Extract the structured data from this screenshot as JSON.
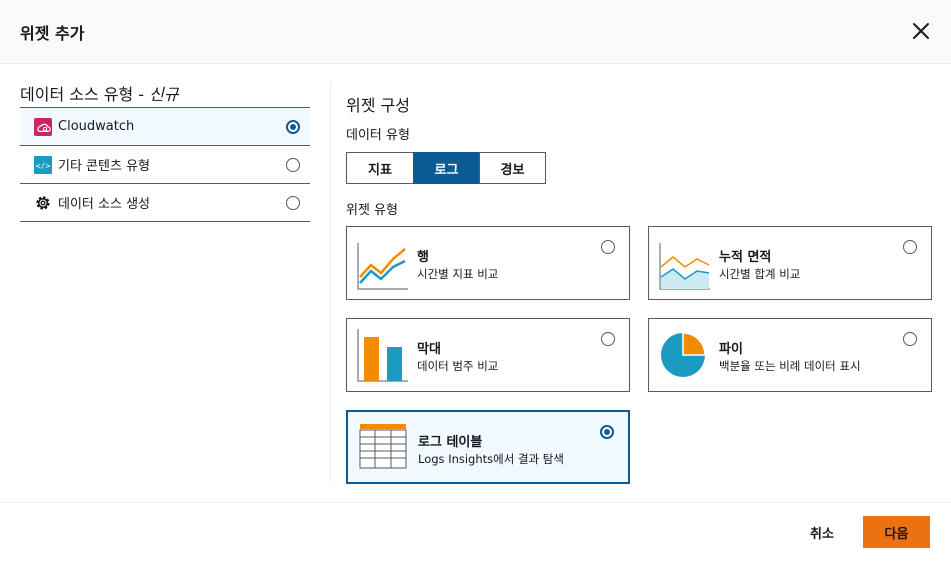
{
  "header": {
    "title": "위젯 추가"
  },
  "sources": {
    "title": "데이터 소스 유형 - ",
    "title_new": "신규",
    "items": [
      {
        "label": "Cloudwatch",
        "icon": "cloudwatch-icon",
        "selected": true
      },
      {
        "label": "기타 콘텐츠 유형",
        "icon": "code-icon",
        "selected": false
      },
      {
        "label": "데이터 소스 생성",
        "icon": "gear-icon",
        "selected": false
      }
    ]
  },
  "config": {
    "title": "위젯 구성",
    "data_type_label": "데이터 유형",
    "data_types": [
      "지표",
      "로그",
      "경보"
    ],
    "selected_data_type": "로그",
    "widget_type_label": "위젯 유형",
    "widgets": [
      {
        "name": "행",
        "desc": "시간별 지표 비교",
        "icon": "line-chart-icon",
        "selected": false
      },
      {
        "name": "누적 면적",
        "desc": "시간별 합계 비교",
        "icon": "stacked-area-icon",
        "selected": false
      },
      {
        "name": "막대",
        "desc": "데이터 범주 비교",
        "icon": "bar-chart-icon",
        "selected": false
      },
      {
        "name": "파이",
        "desc": "백분율 또는 비례 데이터 표시",
        "icon": "pie-chart-icon",
        "selected": false
      },
      {
        "name": "로그 테이블",
        "desc": "Logs Insights에서 결과 탐색",
        "icon": "log-table-icon",
        "selected": true
      }
    ]
  },
  "footer": {
    "cancel_label": "취소",
    "next_label": "다음"
  },
  "colors": {
    "accent_blue": "#0b5b94",
    "primary_orange": "#ec7211",
    "chart_orange": "#f38b00",
    "chart_blue": "#1a9bc1"
  }
}
